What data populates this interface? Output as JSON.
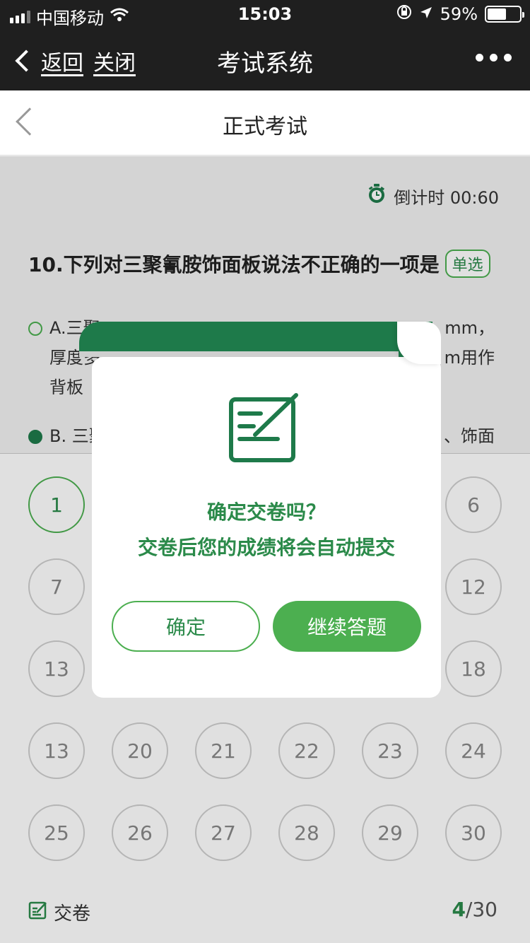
{
  "status": {
    "carrier": "中国移动",
    "time": "15:03",
    "battery_text": "59%",
    "battery_level": 0.59
  },
  "wx_nav": {
    "back_label": "返回",
    "close_label": "关闭",
    "title": "考试系统"
  },
  "page": {
    "title": "正式考试"
  },
  "timer": {
    "label": "倒计时 00:60"
  },
  "question": {
    "text": "10.下列对三聚氰胺饰面板说法不正确的一项是",
    "type_tag": "单选",
    "options": [
      {
        "line1": "A.三聚",
        "line1_end": "mm，",
        "line2": "厚度多",
        "line2_end": "m用作",
        "line3": "背板"
      },
      {
        "line1": "B. 三聚",
        "line1_end": "、饰面"
      }
    ]
  },
  "answer_sheet": {
    "numbers": [
      "1",
      "",
      "",
      "",
      "",
      "6",
      "7",
      "",
      "",
      "",
      "",
      "12",
      "13",
      "",
      "",
      "",
      "",
      "18",
      "13",
      "20",
      "21",
      "22",
      "23",
      "24",
      "25",
      "26",
      "27",
      "28",
      "29",
      "30"
    ],
    "current": "1"
  },
  "footer": {
    "submit_label": "交卷",
    "current": "4",
    "separator": "/",
    "total": "30"
  },
  "modal": {
    "line1": "确定交卷吗？",
    "line2": "交卷后您的成绩将会自动提交",
    "confirm_label": "确定",
    "continue_label": "继续答题"
  },
  "colors": {
    "accent": "#4caf50",
    "accent_dark": "#1e7a4a"
  }
}
